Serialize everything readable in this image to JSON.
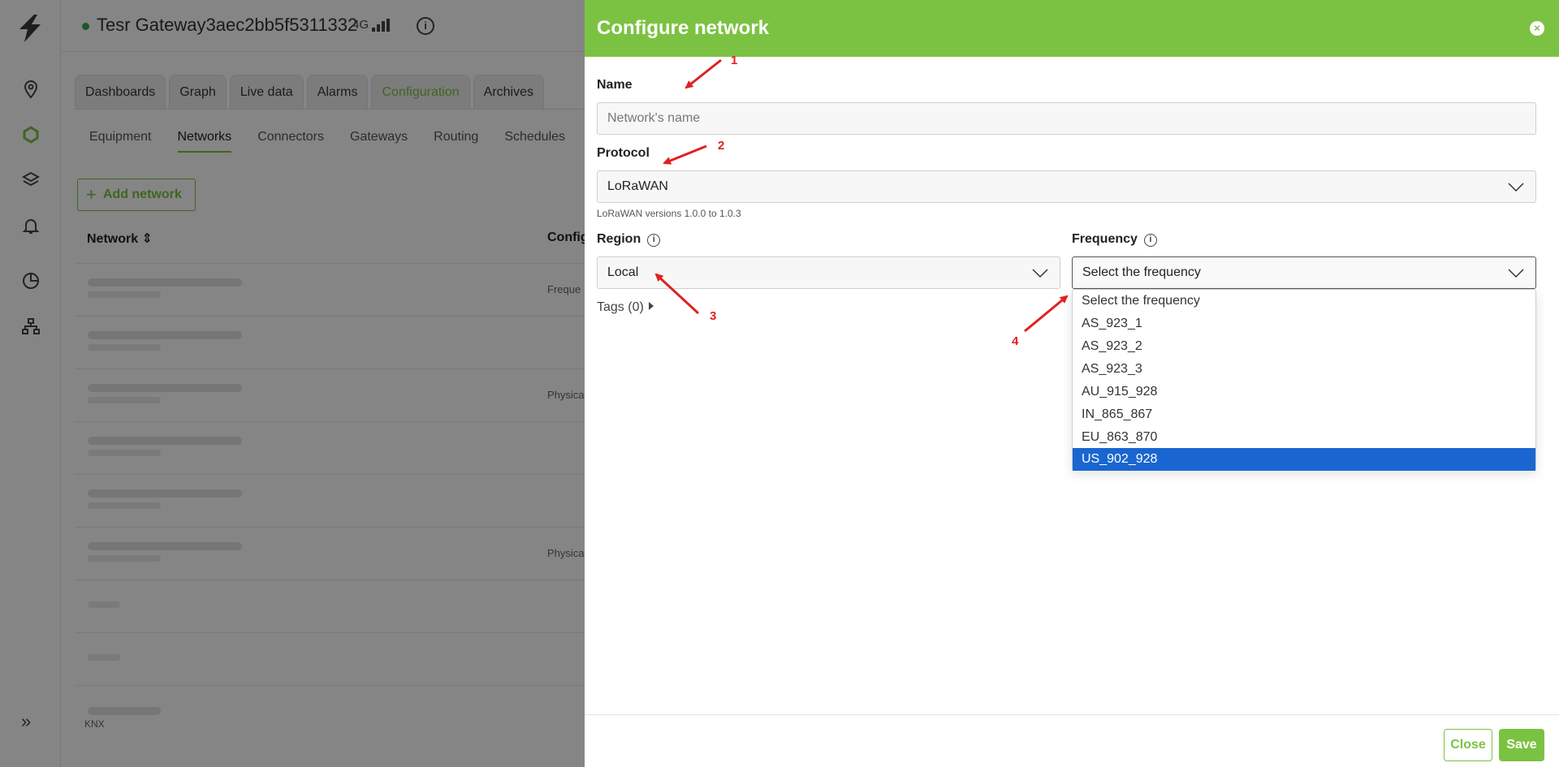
{
  "header": {
    "gateway_name": "Tesr Gateway3aec2bb5f5311332",
    "signal_label": "4G"
  },
  "tabs": [
    {
      "label": "Dashboards"
    },
    {
      "label": "Graph"
    },
    {
      "label": "Live data"
    },
    {
      "label": "Alarms"
    },
    {
      "label": "Configuration"
    },
    {
      "label": "Archives"
    }
  ],
  "subtabs": [
    {
      "label": "Equipment"
    },
    {
      "label": "Networks"
    },
    {
      "label": "Connectors"
    },
    {
      "label": "Gateways"
    },
    {
      "label": "Routing"
    },
    {
      "label": "Schedules"
    }
  ],
  "list": {
    "add_button": "Add network",
    "col_network": "Network",
    "col_config": "Config",
    "row_cfg_freq": "Freque",
    "row_cfg_phys": "Physica",
    "last_row_sub": "KNX"
  },
  "drawer": {
    "title": "Configure network",
    "name_label": "Name",
    "name_placeholder": "Network's name",
    "protocol_label": "Protocol",
    "protocol_value": "LoRaWAN",
    "protocol_hint": "LoRaWAN versions 1.0.0 to 1.0.3",
    "region_label": "Region",
    "region_value": "Local",
    "frequency_label": "Frequency",
    "frequency_value": "Select the frequency",
    "tags_label": "Tags (0)",
    "frequency_options": [
      "Select the frequency",
      "AS_923_1",
      "AS_923_2",
      "AS_923_3",
      "AU_915_928",
      "IN_865_867",
      "EU_863_870",
      "US_902_928"
    ],
    "selected_option": "US_902_928",
    "close_button": "Close",
    "save_button": "Save"
  },
  "annotations": [
    "1",
    "2",
    "3",
    "4"
  ],
  "colors": {
    "brand_green": "#7cc242",
    "selection_blue": "#1a66d1",
    "arrow_red": "#e02020"
  }
}
